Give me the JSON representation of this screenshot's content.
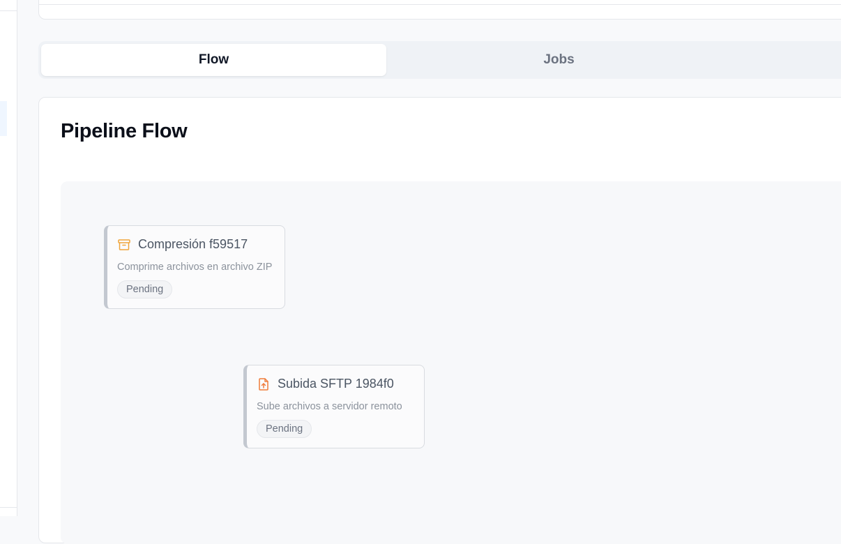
{
  "tabs": [
    {
      "label": "Flow",
      "active": true
    },
    {
      "label": "Jobs",
      "active": false
    }
  ],
  "main": {
    "title": "Pipeline Flow"
  },
  "nodes": [
    {
      "icon": "archive-icon",
      "icon_color": "#f0a53a",
      "title": "Compresión f59517",
      "description": "Comprime archivos en archivo ZIP",
      "status": "Pending"
    },
    {
      "icon": "file-upload-icon",
      "icon_color": "#f07c3a",
      "title": "Subida SFTP 1984f0",
      "description": "Sube archivos a servidor remoto",
      "status": "Pending"
    }
  ]
}
